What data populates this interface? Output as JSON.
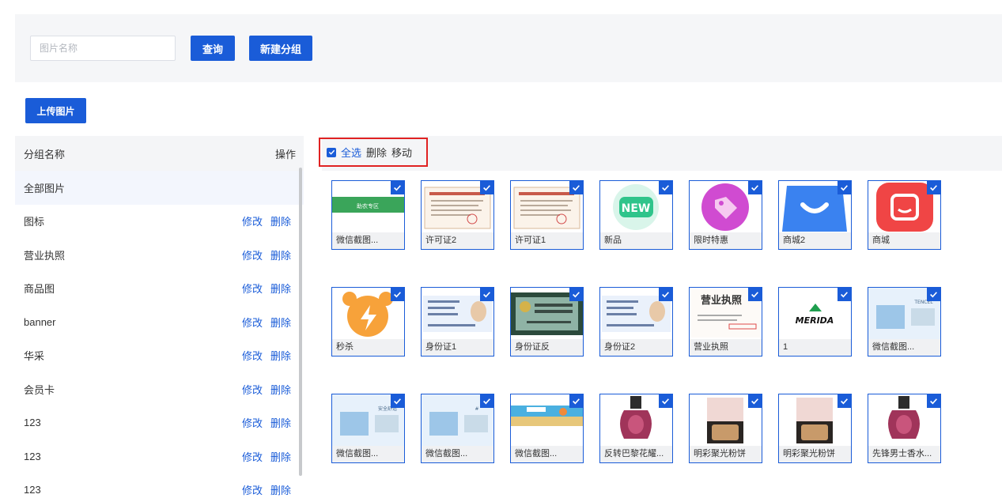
{
  "search": {
    "placeholder": "图片名称",
    "query_label": "查询",
    "new_group_label": "新建分组"
  },
  "upload_label": "上传图片",
  "groups": {
    "header_name": "分组名称",
    "header_action": "操作",
    "edit_label": "修改",
    "delete_label": "删除",
    "items": [
      {
        "label": "全部图片",
        "active": true
      },
      {
        "label": "图标"
      },
      {
        "label": "营业执照"
      },
      {
        "label": "商品图"
      },
      {
        "label": "banner"
      },
      {
        "label": "华采"
      },
      {
        "label": "会员卡"
      },
      {
        "label": "123"
      },
      {
        "label": "123"
      },
      {
        "label": "123"
      }
    ]
  },
  "toolbar": {
    "select_all": "全选",
    "delete": "删除",
    "move": "移动"
  },
  "colors": {
    "accent": "#1a5cd8",
    "highlight_border": "#e02222"
  },
  "images": [
    {
      "name": "微信截图...",
      "icon": "promo-banner",
      "thumb_text": "助农专区"
    },
    {
      "name": "许可证2",
      "icon": "license-document"
    },
    {
      "name": "许可证1",
      "icon": "license-document",
      "thumb_text": "食品经营许可证"
    },
    {
      "name": "新品",
      "icon": "new-badge-icon",
      "thumb_text": "NEW"
    },
    {
      "name": "限时特惠",
      "icon": "tag-icon"
    },
    {
      "name": "商城2",
      "icon": "shopping-bag-icon"
    },
    {
      "name": "商城",
      "icon": "store-icon"
    },
    {
      "name": "秒杀",
      "icon": "alarm-clock-icon"
    },
    {
      "name": "身份证1",
      "icon": "id-card-front"
    },
    {
      "name": "身份证反",
      "icon": "id-card-back"
    },
    {
      "name": "身份证2",
      "icon": "id-card-front"
    },
    {
      "name": "营业执照",
      "icon": "business-license",
      "thumb_text": "营业执照"
    },
    {
      "name": "1",
      "icon": "merida-logo",
      "thumb_text": "MERIDA"
    },
    {
      "name": "微信截图...",
      "icon": "product-banner",
      "thumb_text": "TENCEL"
    },
    {
      "name": "微信截图...",
      "icon": "product-banner",
      "thumb_text": "安全舒适"
    },
    {
      "name": "微信截图...",
      "icon": "product-banner"
    },
    {
      "name": "微信截图...",
      "icon": "beach-banner"
    },
    {
      "name": "反转巴黎花耀...",
      "icon": "perfume-bottle"
    },
    {
      "name": "明彩聚光粉饼",
      "icon": "compact-powder"
    },
    {
      "name": "明彩聚光粉饼",
      "icon": "compact-powder"
    },
    {
      "name": "先锋男士香水...",
      "icon": "perfume-bottle"
    }
  ]
}
